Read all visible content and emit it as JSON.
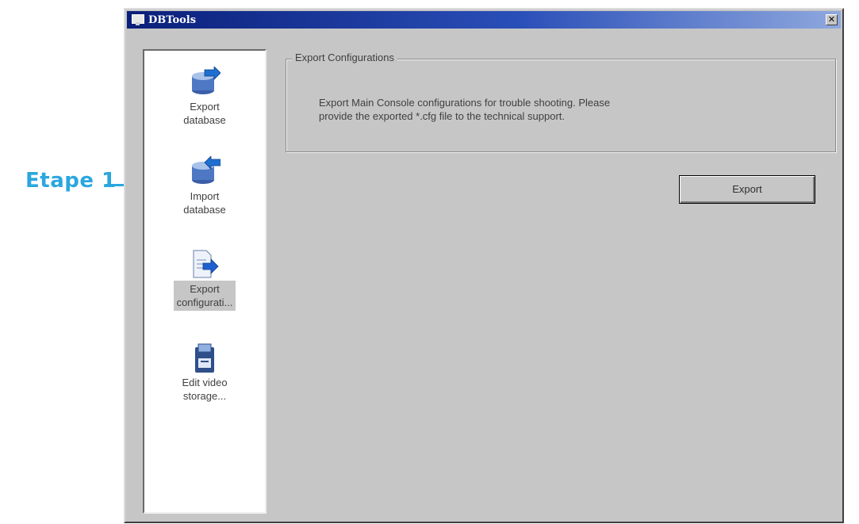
{
  "callout": {
    "label": "Etape 1",
    "color": "#2ba6df"
  },
  "window": {
    "title": "DBTools",
    "close_glyph": "✕"
  },
  "sidebar": {
    "items": [
      {
        "label_line1": "Export",
        "label_line2": "database",
        "icon": "export-database-icon",
        "selected": false
      },
      {
        "label_line1": "Import",
        "label_line2": "database",
        "icon": "import-database-icon",
        "selected": false
      },
      {
        "label_line1": "Export",
        "label_line2": "configurati...",
        "icon": "export-config-icon",
        "selected": true
      },
      {
        "label_line1": "Edit video",
        "label_line2": "storage...",
        "icon": "video-storage-icon",
        "selected": false
      }
    ]
  },
  "main": {
    "group_title": "Export Configurations",
    "description_line1": "Export Main Console configurations for trouble shooting. Please",
    "description_line2": "provide the exported *.cfg file to the technical support.",
    "export_button": "Export"
  }
}
